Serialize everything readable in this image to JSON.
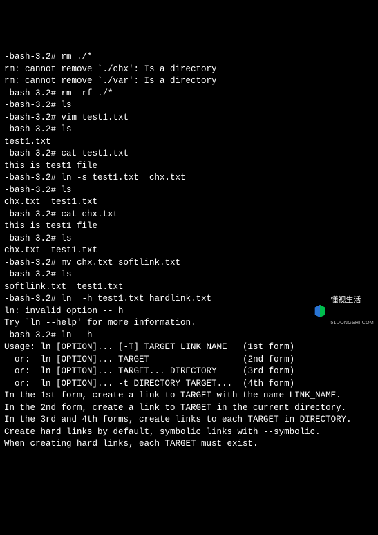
{
  "lines": [
    "-bash-3.2# rm ./*",
    "rm: cannot remove `./chx': Is a directory",
    "rm: cannot remove `./var': Is a directory",
    "-bash-3.2# rm -rf ./*",
    "-bash-3.2# ls",
    "-bash-3.2# vim test1.txt",
    "-bash-3.2# ls",
    "test1.txt",
    "-bash-3.2# cat test1.txt",
    "this is test1 file",
    "-bash-3.2# ln -s test1.txt  chx.txt",
    "-bash-3.2# ls",
    "chx.txt  test1.txt",
    "-bash-3.2# cat chx.txt",
    "this is test1 file",
    "-bash-3.2# ls",
    "chx.txt  test1.txt",
    "-bash-3.2# mv chx.txt softlink.txt",
    "-bash-3.2# ls",
    "softlink.txt  test1.txt",
    "-bash-3.2# ln  -h test1.txt hardlink.txt",
    "ln: invalid option -- h",
    "Try `ln --help' for more information.",
    "-bash-3.2# ln --h",
    "Usage: ln [OPTION]... [-T] TARGET LINK_NAME   (1st form)",
    "  or:  ln [OPTION]... TARGET                  (2nd form)",
    "  or:  ln [OPTION]... TARGET... DIRECTORY     (3rd form)",
    "  or:  ln [OPTION]... -t DIRECTORY TARGET...  (4th form)",
    "In the 1st form, create a link to TARGET with the name LINK_NAME.",
    "In the 2nd form, create a link to TARGET in the current directory.",
    "In the 3rd and 4th forms, create links to each TARGET in DIRECTORY.",
    "Create hard links by default, symbolic links with --symbolic.",
    "When creating hard links, each TARGET must exist."
  ],
  "watermark": {
    "title": "懂视生活",
    "subtitle": "51DONGSHI.COM"
  }
}
